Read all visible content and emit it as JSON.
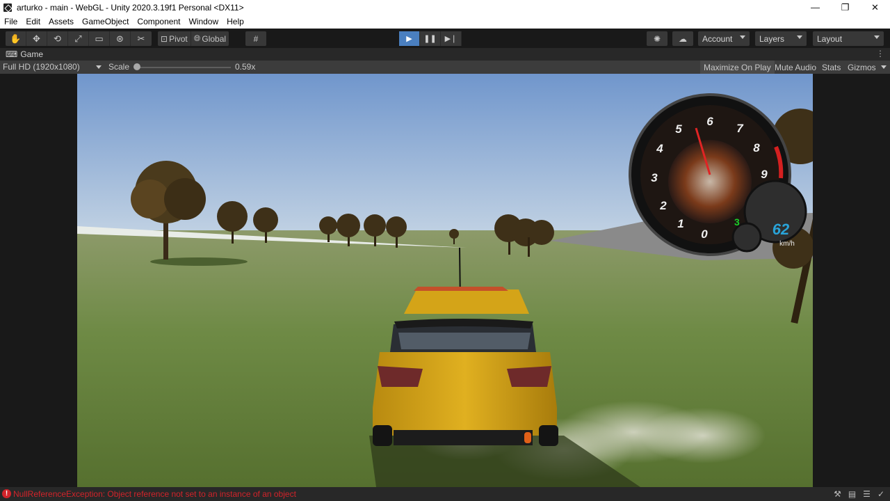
{
  "window": {
    "title": "arturko - main - WebGL - Unity 2020.3.19f1 Personal <DX11>",
    "controls": {
      "minimize": "—",
      "restore": "❐",
      "close": "✕"
    }
  },
  "menu": [
    "File",
    "Edit",
    "Assets",
    "GameObject",
    "Component",
    "Window",
    "Help"
  ],
  "toolbar": {
    "tools": [
      "hand-tool-icon",
      "move-tool-icon",
      "rotate-tool-icon",
      "scale-tool-icon",
      "rect-tool-icon",
      "transform-tool-icon",
      "custom-tool-icon"
    ],
    "pivot_label": "Pivot",
    "global_label": "Global",
    "account_label": "Account",
    "layers_label": "Layers",
    "layout_label": "Layout"
  },
  "game_tab": {
    "label": "Game"
  },
  "game_bar": {
    "resolution": "Full HD (1920x1080)",
    "scale_label": "Scale",
    "scale_value": "0.59x",
    "scale_fraction": 0.02,
    "maximize_on_play": "Maximize On Play",
    "mute_audio": "Mute Audio",
    "stats": "Stats",
    "gizmos": "Gizmos"
  },
  "hud": {
    "tach_numbers": [
      "0",
      "1",
      "2",
      "3",
      "4",
      "5",
      "6",
      "7",
      "8",
      "9"
    ],
    "gear": "3",
    "speed": "62",
    "speed_unit": "km/h"
  },
  "status": {
    "error_message": "NullReferenceException: Object reference not set to an instance of an object"
  },
  "colors": {
    "accent": "#4a7fc0",
    "error": "#d2232a",
    "speed_text": "#29a3d8",
    "gear_text": "#19d229"
  }
}
